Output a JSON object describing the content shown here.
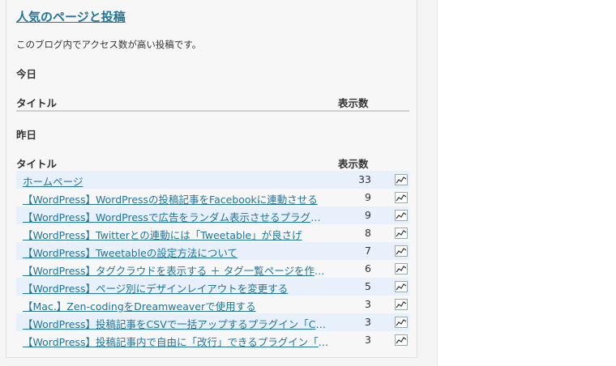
{
  "widget": {
    "title": "人気のページと投稿",
    "description": "このブログ内でアクセス数が高い投稿です。",
    "today": {
      "heading": "今日",
      "col_title": "タイトル",
      "col_views": "表示数"
    },
    "yesterday": {
      "heading": "昨日",
      "col_title": "タイトル",
      "col_views": "表示数",
      "rows": [
        {
          "title": "ホームページ",
          "views": "33"
        },
        {
          "title": "【WordPress】WordPressの投稿記事をFacebookに連動させる",
          "views": "9"
        },
        {
          "title": "【WordPress】WordPressで広告をランダム表示させるプラグイン",
          "views": "9"
        },
        {
          "title": "【WordPress】Twitterとの連動には「Tweetable」が良さげ",
          "views": "8"
        },
        {
          "title": "【WordPress】Tweetableの設定方法について",
          "views": "7"
        },
        {
          "title": "【WordPress】タグクラウドを表示する ＋ タグ一覧ページを作成する",
          "views": "6"
        },
        {
          "title": "【WordPress】ページ別にデザインレイアウトを変更する",
          "views": "5"
        },
        {
          "title": "【Mac.】Zen-codingをDreamweaverで使用する",
          "views": "3"
        },
        {
          "title": "【WordPress】投稿記事をCSVで一括アップするプラグイン「CSV Importer」",
          "views": "3"
        },
        {
          "title": "【WordPress】投稿記事内で自由に「改行」できるプラグイン「TinyMCE Advanced」",
          "views": "3"
        }
      ]
    }
  },
  "icons": {
    "row_graph": "line-chart-icon"
  },
  "colors": {
    "link": "#21759b",
    "row_highlight": "#e8f0fb",
    "panel": "#f7f7f7"
  }
}
